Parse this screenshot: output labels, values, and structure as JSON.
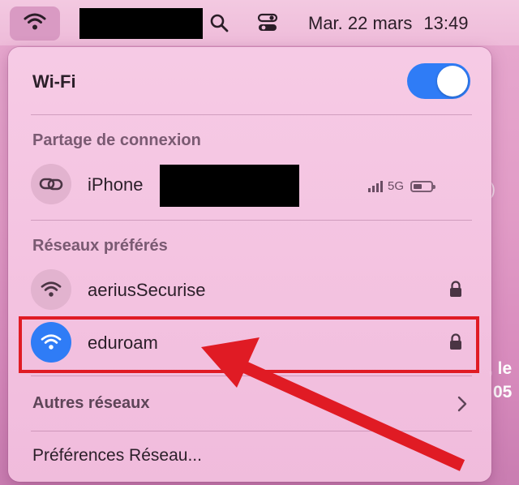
{
  "menubar": {
    "date": "Mar. 22 mars",
    "time": "13:49",
    "icons": [
      "wifi-icon",
      "search-icon",
      "control-center-icon"
    ]
  },
  "wifi": {
    "title": "Wi-Fi",
    "enabled": true
  },
  "hotspot": {
    "section_title": "Partage de connexion",
    "device_label": "iPhone",
    "network_type": "5G",
    "signal_bars": 4
  },
  "preferred": {
    "section_title": "Réseaux préférés",
    "networks": [
      {
        "name": "aeriusSecurise",
        "secured": true,
        "connected": false
      },
      {
        "name": "eduroam",
        "secured": true,
        "connected": true
      }
    ]
  },
  "other_networks": {
    "label": "Autres réseaux"
  },
  "network_prefs": {
    "label": "Préférences Réseau..."
  },
  "background_fragments": [
    ", le",
    "05",
    ")"
  ],
  "colors": {
    "accent": "#2f7cf6",
    "highlight": "#e01b24",
    "panel": "#f4c3df"
  }
}
